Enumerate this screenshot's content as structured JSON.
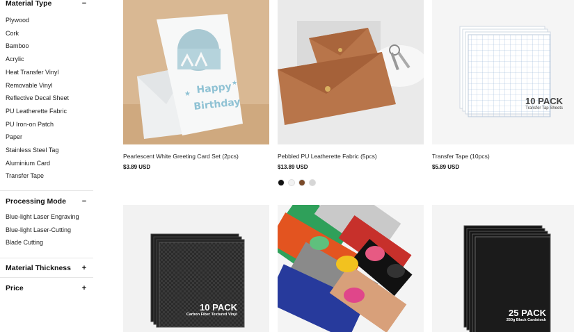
{
  "filters": {
    "material_type": {
      "title": "Material Type",
      "toggle": "−",
      "items": [
        "Plywood",
        "Cork",
        "Bamboo",
        "Acrylic",
        "Heat Transfer Vinyl",
        "Removable Vinyl",
        "Reflective Decal Sheet",
        "PU Leatherette Fabric",
        "PU Iron-on Patch",
        "Paper",
        "Stainless Steel Tag",
        "Aluminium Card",
        "Transfer Tape"
      ]
    },
    "processing_mode": {
      "title": "Processing Mode",
      "toggle": "−",
      "items": [
        "Blue-light Laser Engraving",
        "Blue-light Laser-Cutting",
        "Blade Cutting"
      ]
    },
    "material_thickness": {
      "title": "Material Thickness",
      "toggle": "+"
    },
    "price": {
      "title": "Price",
      "toggle": "+"
    }
  },
  "products": [
    {
      "name": "Pearlescent White Greeting Card Set (2pcs)",
      "price": "$3.89 USD",
      "image_text": {
        "line1": "Happy",
        "line2": "Birthday"
      }
    },
    {
      "name": "Pebbled PU Leatherette Fabric (5pcs)",
      "price": "$13.89 USD",
      "swatches": [
        "#111111",
        "#f2f2f2",
        "#7a4a2a",
        "#d6d6d6"
      ]
    },
    {
      "name": "Transfer Tape (10pcs)",
      "price": "$5.89 USD",
      "pack": "10 PACK",
      "pack_sub": "Transfer Tap Sheets"
    },
    {
      "pack": "10 PACK",
      "pack_sub": "Carbon Fiber Textured Vinyl"
    },
    {
      "image": "vinyl-rolls"
    },
    {
      "pack": "25 PACK",
      "pack_sub": "250g Black Cardstock"
    }
  ],
  "colors": {
    "thumb_bg": "#f4f4f4",
    "accent_leather": "#b8754a"
  }
}
